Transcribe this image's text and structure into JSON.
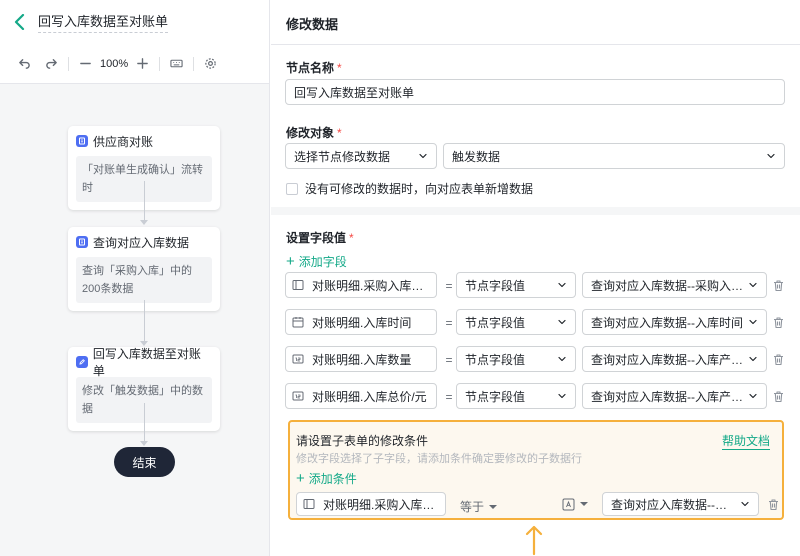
{
  "flow": {
    "title": "回写入库数据至对账单",
    "zoom": "100%",
    "nodes": [
      {
        "title": "供应商对账",
        "desc": "「对账单生成确认」流转时"
      },
      {
        "title": "查询对应入库数据",
        "desc": "查询「采购入库」中的200条数据"
      },
      {
        "title": "回写入库数据至对账单",
        "desc": "修改「触发数据」中的数据"
      }
    ],
    "end_label": "结束"
  },
  "panel": {
    "title": "修改数据",
    "node_name_label": "节点名称",
    "node_name_value": "回写入库数据至对账单",
    "target_label": "修改对象",
    "target_select_1": "选择节点修改数据",
    "target_select_2": "触发数据",
    "checkbox_label": "没有可修改的数据时，向对应表单新增数据",
    "field_values_label": "设置字段值",
    "add_field": "添加字段",
    "equals": "=",
    "rows": [
      {
        "field": "对账明细.采购入库单编码",
        "type": "节点字段值",
        "value": "查询对应入库数据--采购入库单..."
      },
      {
        "field": "对账明细.入库时间",
        "type": "节点字段值",
        "value": "查询对应入库数据--入库时间"
      },
      {
        "field": "对账明细.入库数量",
        "type": "节点字段值",
        "value": "查询对应入库数据--入库产品总数"
      },
      {
        "field": "对账明细.入库总价/元",
        "type": "节点字段值",
        "value": "查询对应入库数据--入库产品采..."
      }
    ],
    "sub": {
      "title": "请设置子表单的修改条件",
      "help": "帮助文档",
      "hint": "修改字段选择了子字段，请添加条件确定要修改的子数据行",
      "add_condition": "添加条件",
      "cond_field": "对账明细.采购入库单编码",
      "cond_op": "等于",
      "cond_value": "查询对应入库数据--采购..."
    }
  },
  "colors": {
    "accent": "#14a988",
    "highlight_border": "#f5b03c",
    "required": "#f54a45",
    "end_node": "#1f2637"
  }
}
